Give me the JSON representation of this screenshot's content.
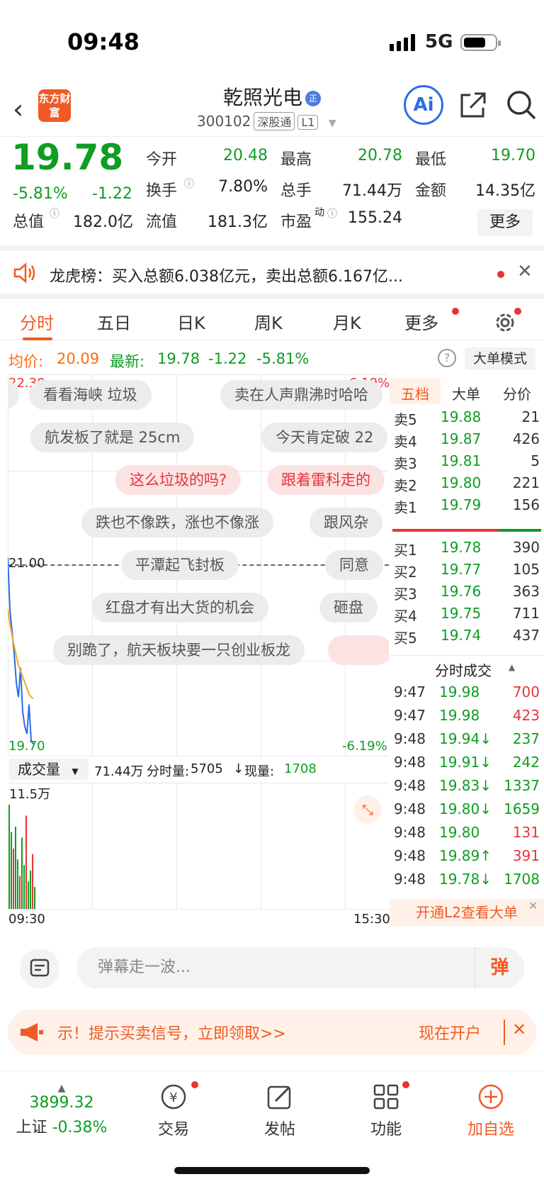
{
  "status": {
    "time": "09:48",
    "network": "5G"
  },
  "header": {
    "logo": "东方财富",
    "name": "乾照光电",
    "name_tag": "正",
    "code": "300102",
    "market": "深股通",
    "level": "L1"
  },
  "quote": {
    "price": "19.78",
    "change_pct": "-5.81%",
    "change": "-1.22",
    "open_label": "今开",
    "open": "20.48",
    "high_label": "最高",
    "high": "20.78",
    "low_label": "最低",
    "low": "19.70",
    "turnover_label": "换手",
    "turnover": "7.80%",
    "volume_label": "总手",
    "volume": "71.44万",
    "amount_label": "金额",
    "amount": "14.35亿",
    "mcap_label": "总值",
    "mcap": "182.0亿",
    "float_label": "流值",
    "float": "181.3亿",
    "pe_label": "市盈",
    "pe_sup": "动",
    "pe": "155.24",
    "more": "更多"
  },
  "notice": {
    "text": "龙虎榜：买入总额6.038亿元，卖出总额6.167亿..."
  },
  "tabs": [
    "分时",
    "五日",
    "日K",
    "周K",
    "月K",
    "更多"
  ],
  "chart_info": {
    "avg_label": "均价:",
    "avg": "20.09",
    "latest_label": "最新:",
    "latest": "19.78",
    "latest_chg": "-1.22",
    "latest_pct": "-5.81%",
    "big_order_mode": "大单模式"
  },
  "chart_axes": {
    "top_price": "22.30",
    "top_pct": "6.19%",
    "mid_price": "21.00",
    "bottom_price": "19.70",
    "bottom_pct": "-6.19%",
    "time_start": "09:30",
    "time_end": "15:30"
  },
  "chart_data": {
    "type": "line",
    "title": "",
    "xlabel": "",
    "ylabel": "",
    "ylim": [
      19.7,
      22.3
    ],
    "series": [
      {
        "values": [
          21.05,
          20.7,
          20.55,
          20.4,
          20.2,
          20.1,
          20.3,
          20.0,
          19.9,
          19.85,
          20.05,
          19.8,
          19.78
        ]
      },
      {
        "values": [
          20.7,
          20.6,
          20.52,
          20.45,
          20.38,
          20.32,
          20.28,
          20.24,
          20.2,
          20.16,
          20.12,
          20.1,
          20.09
        ]
      }
    ],
    "volume": [
      9.5,
      7.0,
      5.5,
      7.5,
      4.5,
      3.0,
      6.5,
      4.0,
      8.5,
      2.5,
      3.5,
      5.0,
      2.0
    ],
    "volume_ylim": [
      0,
      11.5
    ],
    "volume_top_label": "11.5万"
  },
  "danmu": [
    {
      "text": "看看海峡 垃圾",
      "pink": false
    },
    {
      "text": "卖在人声鼎沸时哈哈",
      "pink": false
    },
    {
      "text": "航发板了就是 25cm",
      "pink": false
    },
    {
      "text": "今天肯定破 22",
      "pink": false
    },
    {
      "text": "这么垃圾的吗?",
      "pink": true
    },
    {
      "text": "跟着雷科走的",
      "pink": true
    },
    {
      "text": "跌也不像跌，涨也不像涨",
      "pink": false
    },
    {
      "text": "跟风杂",
      "pink": false
    },
    {
      "text": "平潭起飞封板",
      "pink": false
    },
    {
      "text": "同意",
      "pink": false
    },
    {
      "text": "红盘才有出大货的机会",
      "pink": false
    },
    {
      "text": "砸盘",
      "pink": false
    },
    {
      "text": "别跪了，航天板块要一只创业板龙",
      "pink": false
    }
  ],
  "volume_bar": {
    "label": "成交量",
    "total": "71.44万",
    "min_label": "分时量:",
    "min_vol": "5705",
    "cur_label": "现量:",
    "cur": "1708"
  },
  "book": {
    "tabs": [
      "五档",
      "大单",
      "分价"
    ],
    "asks": [
      {
        "label": "卖5",
        "price": "19.88",
        "vol": "21"
      },
      {
        "label": "卖4",
        "price": "19.87",
        "vol": "426"
      },
      {
        "label": "卖3",
        "price": "19.81",
        "vol": "5"
      },
      {
        "label": "卖2",
        "price": "19.80",
        "vol": "221"
      },
      {
        "label": "卖1",
        "price": "19.79",
        "vol": "156"
      }
    ],
    "bids": [
      {
        "label": "买1",
        "price": "19.78",
        "vol": "390"
      },
      {
        "label": "买2",
        "price": "19.77",
        "vol": "105"
      },
      {
        "label": "买3",
        "price": "19.76",
        "vol": "363"
      },
      {
        "label": "买4",
        "price": "19.75",
        "vol": "711"
      },
      {
        "label": "买5",
        "price": "19.74",
        "vol": "437"
      }
    ]
  },
  "trades": {
    "title": "分时成交",
    "rows": [
      {
        "t": "9:47",
        "p": "19.98",
        "v": "700",
        "vc": "red"
      },
      {
        "t": "9:47",
        "p": "19.98",
        "v": "423",
        "vc": "red"
      },
      {
        "t": "9:48",
        "p": "19.94↓",
        "v": "237",
        "vc": "green"
      },
      {
        "t": "9:48",
        "p": "19.91↓",
        "v": "242",
        "vc": "green"
      },
      {
        "t": "9:48",
        "p": "19.83↓",
        "v": "1337",
        "vc": "green"
      },
      {
        "t": "9:48",
        "p": "19.80↓",
        "v": "1659",
        "vc": "green"
      },
      {
        "t": "9:48",
        "p": "19.80",
        "v": "131",
        "vc": "red"
      },
      {
        "t": "9:48",
        "p": "19.89↑",
        "v": "391",
        "vc": "red"
      },
      {
        "t": "9:48",
        "p": "19.78↓",
        "v": "1708",
        "vc": "green"
      }
    ],
    "l2": "开通L2查看大单"
  },
  "comment": {
    "placeholder": "弹幕走一波...",
    "button": "弹"
  },
  "promo": {
    "text": "示！提示买卖信号，立即领取>>",
    "open": "现在开户"
  },
  "bottom_nav": {
    "index_value": "3899.32",
    "index_name": "上证",
    "index_pct": "-0.38%",
    "trade": "交易",
    "post": "发帖",
    "func": "功能",
    "add": "加自选"
  },
  "colors": {
    "red": "#e8333a",
    "green": "#0f9d22",
    "orange": "#f15a24",
    "blue": "#2b6de8"
  }
}
